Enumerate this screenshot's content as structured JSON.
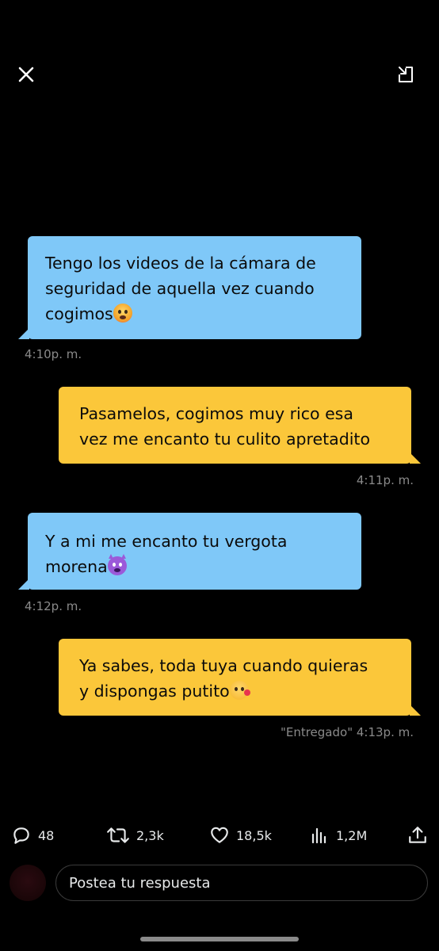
{
  "toolbar": {
    "close_icon": "close-icon",
    "restore_icon": "minimize-to-window-icon"
  },
  "messages": [
    {
      "direction": "incoming",
      "lines": [
        "Tengo los videos de la cámara de",
        "seguridad de aquella vez cuando",
        "cogimos"
      ],
      "emoji": "flushed-face",
      "time": "4:10p. m."
    },
    {
      "direction": "outgoing",
      "lines": [
        "Pasamelos, cogimos muy rico esa",
        "vez me encanto tu culito apretadito"
      ],
      "time": "4:11p. m."
    },
    {
      "direction": "incoming",
      "lines": [
        "Y a mi me encanto tu vergota",
        "morena"
      ],
      "emoji": "smiling-devil",
      "time": "4:12p. m."
    },
    {
      "direction": "outgoing",
      "lines": [
        "Ya sabes, toda tuya cuando quieras",
        "y dispongas putito"
      ],
      "emoji": "face-blowing-kiss",
      "time": "\"Entregado\" 4:13p. m."
    }
  ],
  "actions": {
    "replies": {
      "icon": "reply-icon",
      "count": "48"
    },
    "reposts": {
      "icon": "repost-icon",
      "count": "2,3k"
    },
    "likes": {
      "icon": "heart-icon",
      "count": "18,5k"
    },
    "views": {
      "icon": "views-icon",
      "count": "1,2M"
    },
    "share": {
      "icon": "share-icon"
    }
  },
  "reply": {
    "placeholder": "Postea tu respuesta"
  },
  "colors": {
    "incoming_bubble": "#7fc8f8",
    "outgoing_bubble": "#fbc73a",
    "background": "#000000",
    "timestamp": "#8a8a8a"
  }
}
